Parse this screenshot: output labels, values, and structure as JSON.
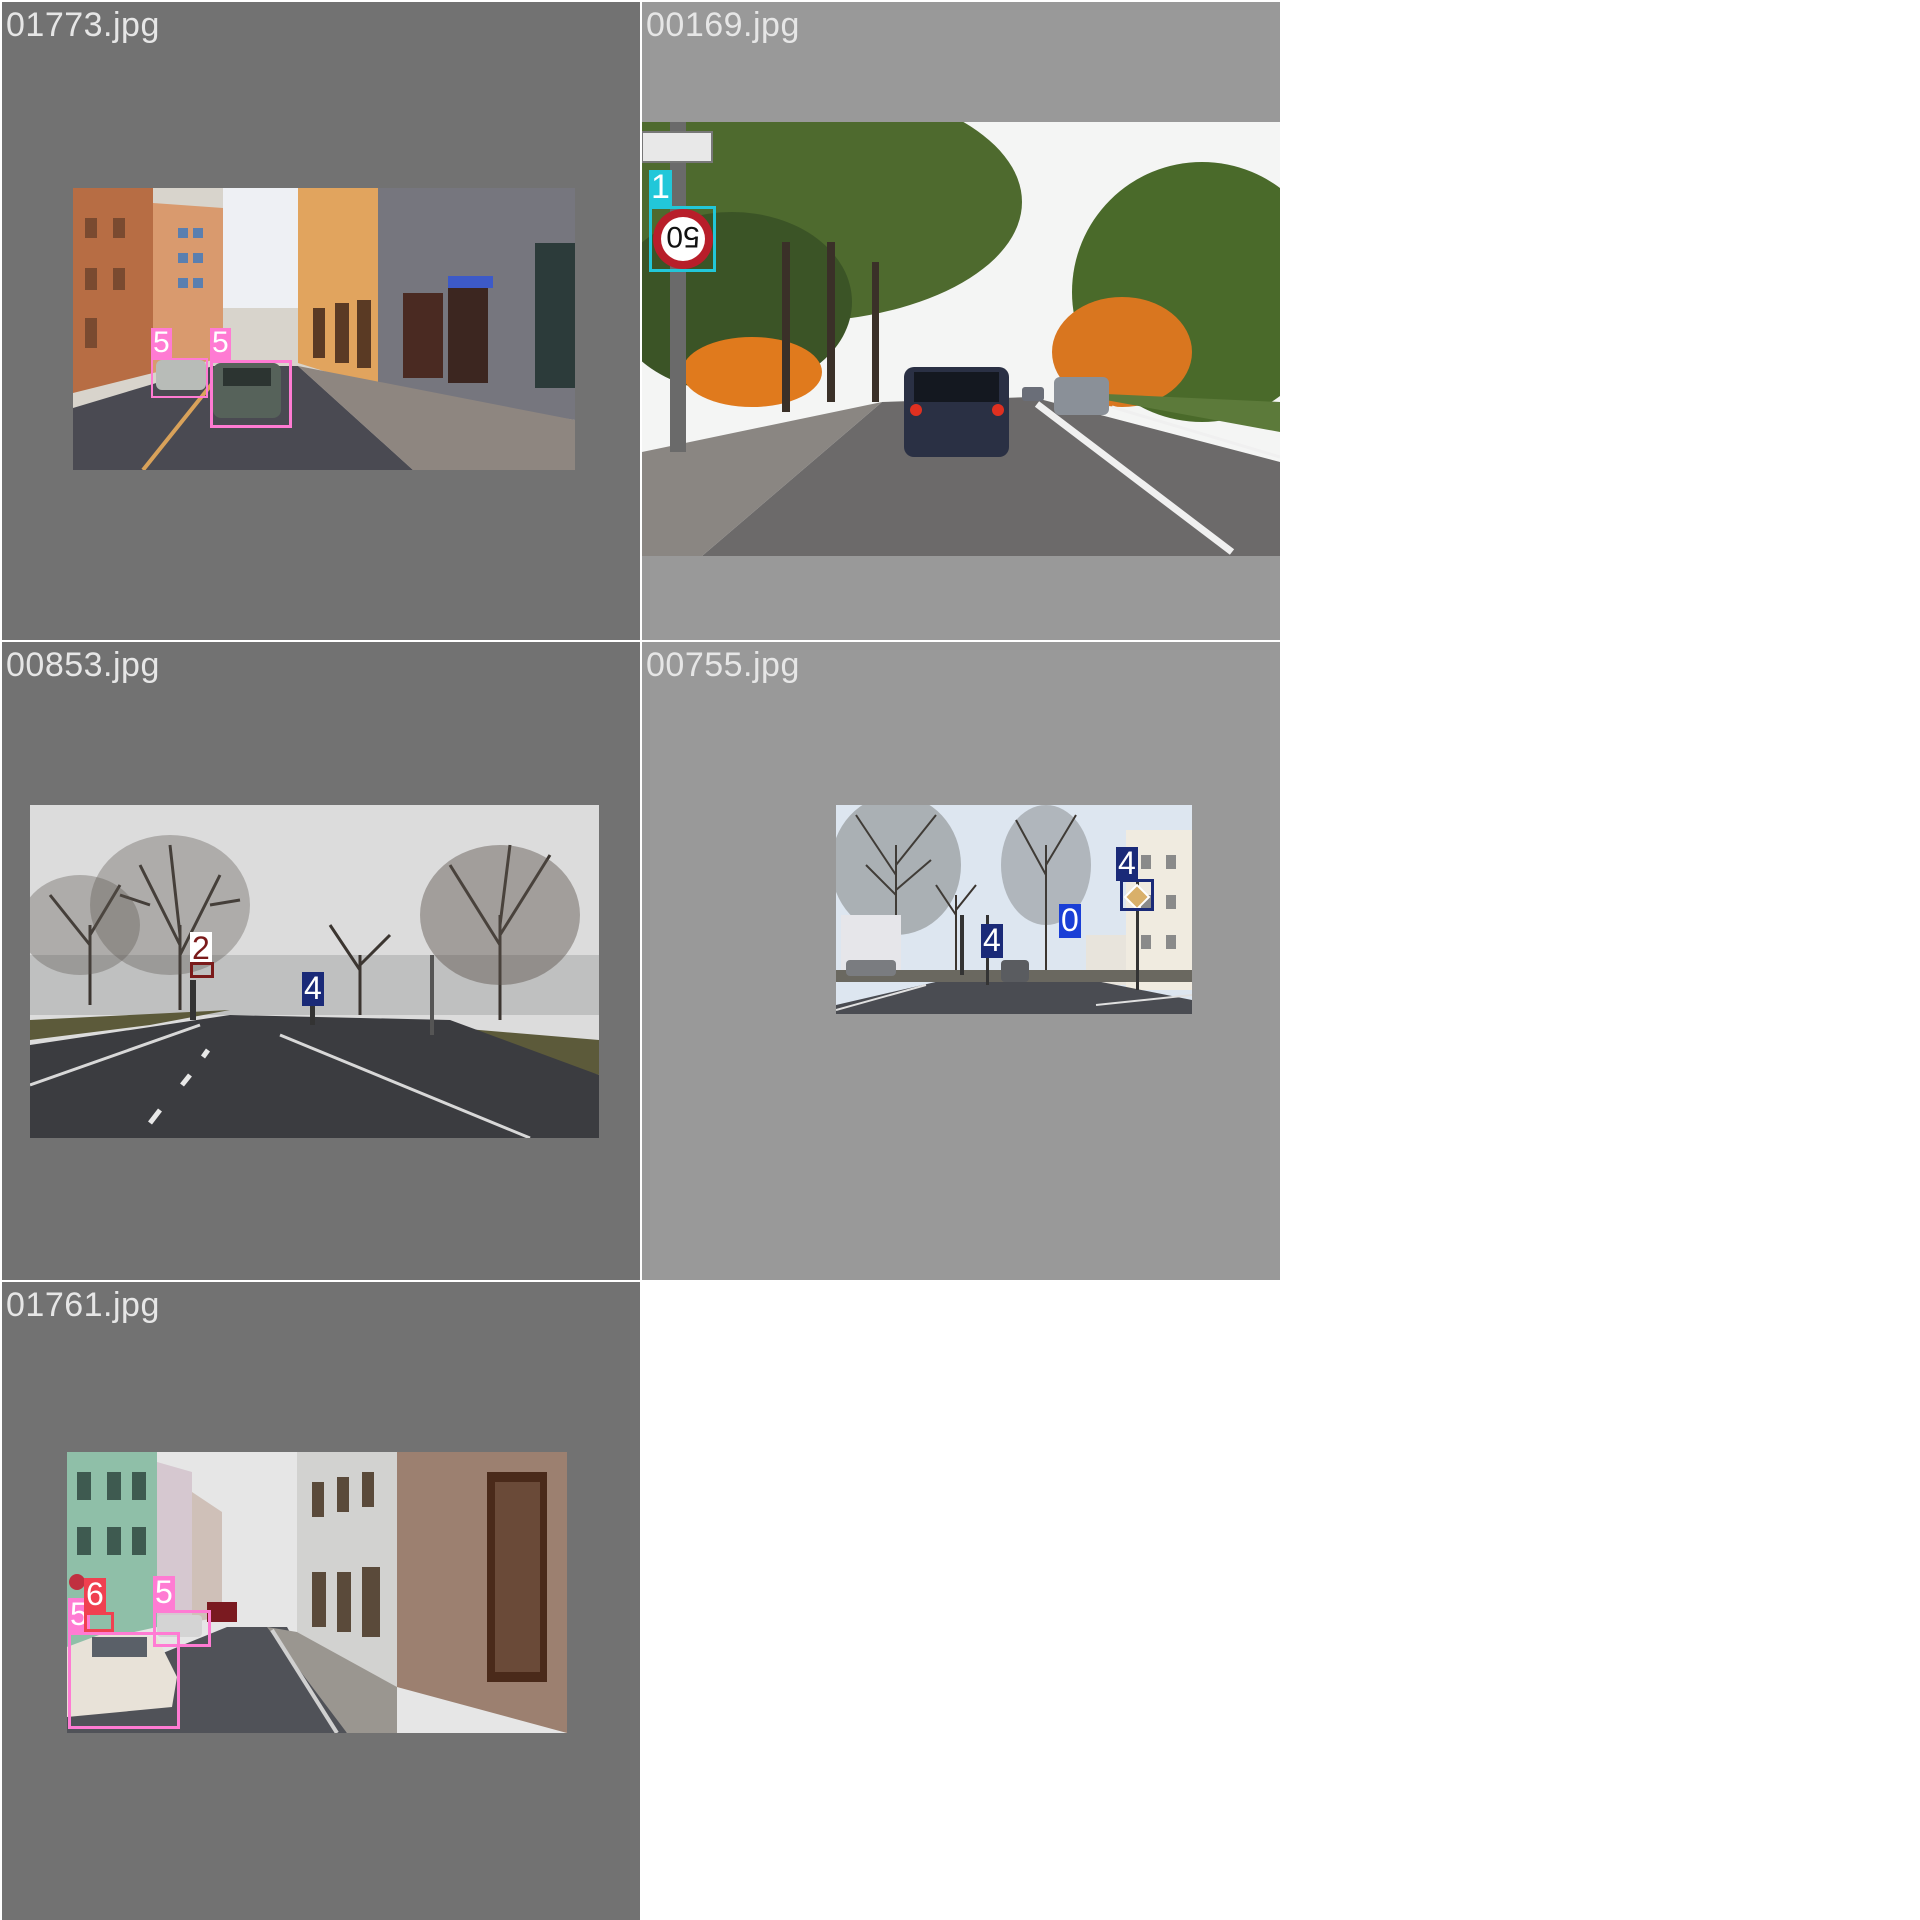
{
  "tiles": [
    {
      "filename": "01773.jpg",
      "scene": "city street with buildings and two cars",
      "detections": [
        {
          "label": "5",
          "color": "#ff7bd3"
        },
        {
          "label": "5",
          "color": "#ff7bd3"
        }
      ]
    },
    {
      "filename": "00169.jpg",
      "scene": "tree-lined road with speed limit sign and dark car",
      "detections": [
        {
          "label": "1",
          "color": "#22c7d9"
        }
      ]
    },
    {
      "filename": "00853.jpg",
      "scene": "wet road in fog with bare trees",
      "detections": [
        {
          "label": "2",
          "color": "#7a1a1a"
        },
        {
          "label": "4",
          "color": "#1a2a78"
        }
      ]
    },
    {
      "filename": "00755.jpg",
      "scene": "suburban street with bare trees and traffic signs",
      "detections": [
        {
          "label": "4",
          "color": "#1a2a78"
        },
        {
          "label": "0",
          "color": "#1a3fd6"
        },
        {
          "label": "4",
          "color": "#1a2a78"
        }
      ]
    },
    {
      "filename": "01761.jpg",
      "scene": "narrow city street with parked white car",
      "detections": [
        {
          "label": "5",
          "color": "#ff7bd3"
        },
        {
          "label": "6",
          "color": "#f04050"
        },
        {
          "label": "5",
          "color": "#ff7bd3"
        }
      ]
    }
  ],
  "sign_text": "50"
}
